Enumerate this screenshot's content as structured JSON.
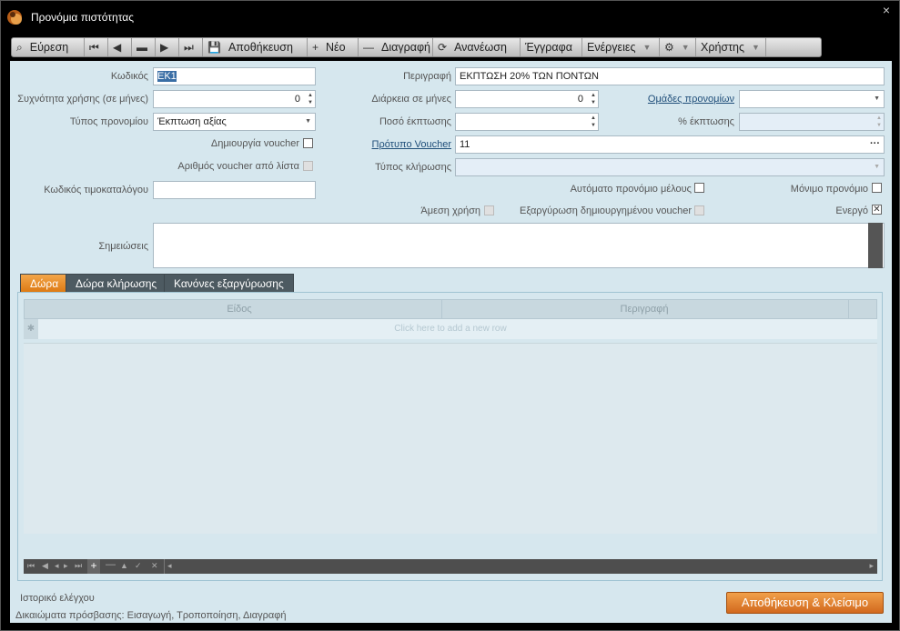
{
  "window": {
    "title": "Προνόμια πιστότητας",
    "close": "×"
  },
  "toolbar": [
    {
      "label": "Εύρεση",
      "icon": "⌕",
      "name": "search-button",
      "dis": false,
      "dd": false
    },
    {
      "label": "",
      "icon": "⏮",
      "name": "first-record-button",
      "dis": true,
      "dd": false
    },
    {
      "label": "",
      "icon": "◀",
      "name": "previous-record-button",
      "dis": true,
      "dd": false
    },
    {
      "label": "",
      "icon": "▬",
      "name": "list-button",
      "dis": true,
      "dd": false
    },
    {
      "label": "",
      "icon": "▶",
      "name": "next-record-button",
      "dis": true,
      "dd": false
    },
    {
      "label": "",
      "icon": "⏭",
      "name": "last-record-button",
      "dis": true,
      "dd": false
    },
    {
      "label": "Αποθήκευση",
      "icon": "💾",
      "name": "save-button",
      "dis": false,
      "dd": false
    },
    {
      "label": "Νέο",
      "icon": "+",
      "name": "new-button",
      "dis": false,
      "dd": false
    },
    {
      "label": "Διαγραφή",
      "icon": "—",
      "name": "delete-button",
      "dis": false,
      "dd": false
    },
    {
      "label": "Ανανέωση",
      "icon": "⟳",
      "name": "refresh-button",
      "dis": false,
      "dd": false
    },
    {
      "label": "Έγγραφα",
      "icon": "",
      "name": "documents-button",
      "dis": false,
      "dd": false
    },
    {
      "label": "Ενέργειες",
      "icon": "",
      "name": "actions-button",
      "dis": false,
      "dd": true
    },
    {
      "label": "",
      "icon": "⚙",
      "name": "settings-button",
      "dis": false,
      "dd": true
    },
    {
      "label": "Χρήστης",
      "icon": "",
      "name": "user-button",
      "dis": false,
      "dd": true
    }
  ],
  "fields": {
    "code_label": "Κωδικός",
    "code_value": "ΕΚ1",
    "description_label": "Περιγραφή",
    "description_value": "ΕΚΠΤΩΣΗ 20% ΤΩΝ ΠΟΝΤΩΝ",
    "frequency_label": "Συχνότητα χρήσης (σε μήνες)",
    "frequency_value": "0",
    "duration_label": "Διάρκεια σε μήνες",
    "duration_value": "0",
    "groups_label": "Ομάδες προνομίων",
    "groups_value": "",
    "type_label": "Τύπος προνομίου",
    "type_value": "Έκπτωση αξίας",
    "amount_label": "Ποσό έκπτωσης",
    "amount_value": "",
    "percent_label": "% έκπτωσης",
    "percent_value": "",
    "create_voucher_label": "Δημιουργία voucher",
    "voucher_template_label": "Πρότυπο Voucher",
    "voucher_template_value": "11",
    "voucher_from_list_label": "Αριθμός voucher από λίστα",
    "draw_type_label": "Τύπος κλήρωσης",
    "draw_type_value": "",
    "price_code_label": "Κωδικός τιμοκαταλόγου",
    "price_code_value": "",
    "auto_member_label": "Αυτόματο προνόμιο μέλους",
    "permanent_label": "Μόνιμο προνόμιο",
    "immediate_label": "Άμεση χρήση",
    "redeem_label": "Εξαργύρωση δημιουργημένου voucher",
    "active_label": "Ενεργό",
    "notes_label": "Σημειώσεις",
    "notes_value": ""
  },
  "tabs": [
    "Δώρα",
    "Δώρα κλήρωσης",
    "Κανόνες εξαργύρωσης"
  ],
  "grid": {
    "columns": [
      "Είδος",
      "Περιγραφή"
    ],
    "new_row": "Click here to add a new row"
  },
  "footer": {
    "audit": "Ιστορικό ελέγχου",
    "rights": "Δικαιώματα πρόσβασης:  Εισαγωγή, Τροποποίηση, Διαγραφή",
    "save_close": "Αποθήκευση & Κλείσιμο"
  },
  "colors": {
    "accent": "#e0801c",
    "form_bg": "#d6e7ee"
  }
}
